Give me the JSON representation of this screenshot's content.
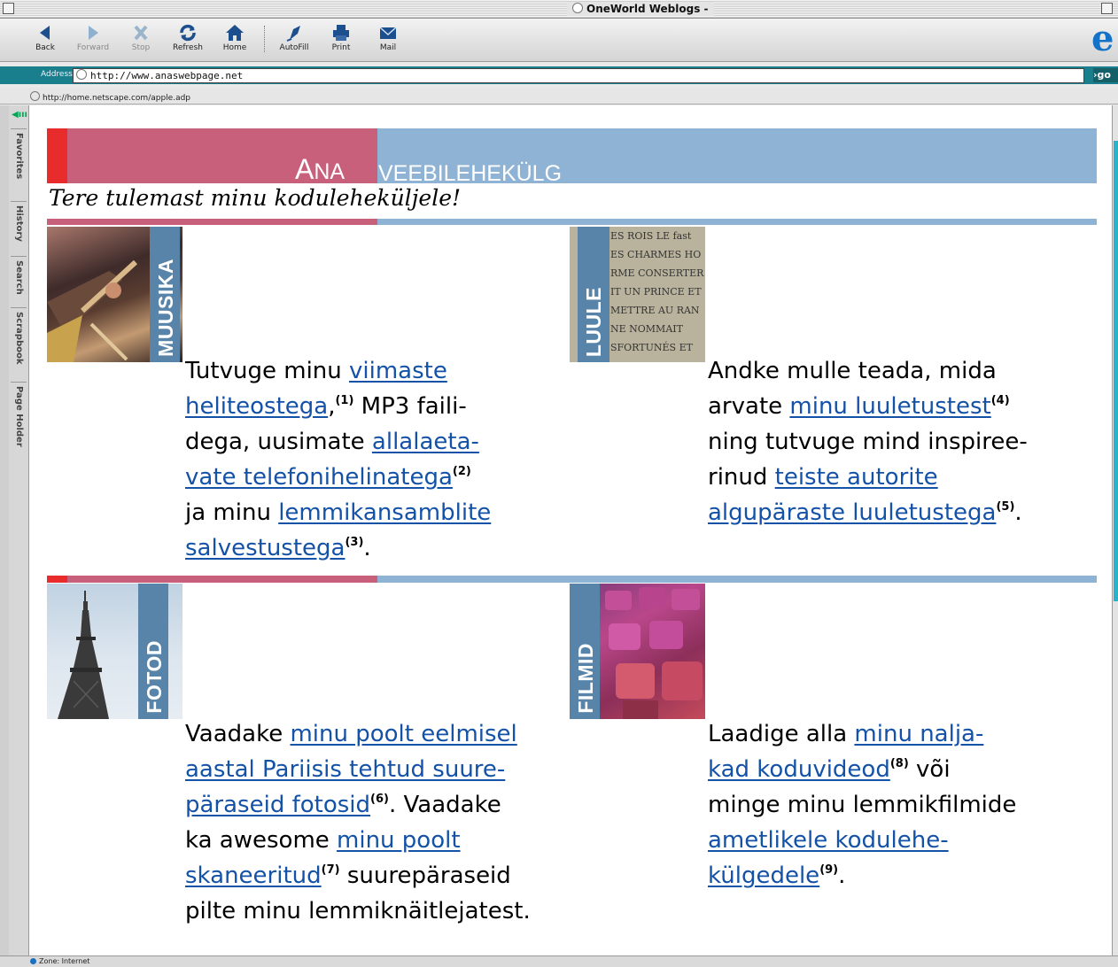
{
  "window": {
    "title": "OneWorld Weblogs -"
  },
  "toolbar": {
    "buttons": [
      {
        "label": "Back",
        "icon": "back-arrow-icon"
      },
      {
        "label": "Forward",
        "icon": "forward-arrow-icon"
      },
      {
        "label": "Stop",
        "icon": "stop-icon"
      },
      {
        "label": "Refresh",
        "icon": "refresh-icon"
      },
      {
        "label": "Home",
        "icon": "home-icon"
      },
      {
        "label": "AutoFill",
        "icon": "autofill-icon"
      },
      {
        "label": "Print",
        "icon": "print-icon"
      },
      {
        "label": "Mail",
        "icon": "mail-icon"
      }
    ],
    "brand_icon": "internet-explorer-e-icon",
    "brand_glyph": "e"
  },
  "address_bar": {
    "label": "Address:",
    "url": "http://www.anaswebpage.net",
    "go_label": "go"
  },
  "favorites_bar": {
    "item": "http://home.netscape.com/apple.adp"
  },
  "explorer_bar": {
    "tabs": [
      "Favorites",
      "History",
      "Search",
      "Scrapbook",
      "Page Holder"
    ],
    "toggle_glyph": "◀ııı"
  },
  "status_bar": {
    "text": "Zone: Internet"
  },
  "page": {
    "banner": {
      "title_first_letter": "A",
      "title_rest": "NA",
      "title_second": "VEEBILEHEKÜLG",
      "welcome": "Tere tulemast minu koduleheküljele!"
    },
    "colors": {
      "red": "#e82c2c",
      "pink": "#c85f7b",
      "blue": "#8fb3d5",
      "label_band": "#5784a8",
      "link": "#1452a8"
    },
    "sections": {
      "music": {
        "label": "MUUSIKA",
        "lines": [
          {
            "pre": "Tutvuge minu ",
            "link": "viimaste",
            "post": "",
            "sup": ""
          },
          {
            "pre": "",
            "link": "heliteostega",
            "post": " MP3 faili-",
            "sup": "(1)",
            "comma": ","
          },
          {
            "pre": "dega, uusimate ",
            "link": "allalaeta-",
            "post": "",
            "sup": ""
          },
          {
            "pre": "",
            "link": "vate telefonihelinatega",
            "post": "",
            "sup": "(2)"
          },
          {
            "pre": "ja minu ",
            "link": "lemmikansamblite",
            "post": "",
            "sup": ""
          },
          {
            "pre": "",
            "link": "salvestustega",
            "post": ".",
            "sup": "(3)"
          }
        ]
      },
      "poetry": {
        "label": "LUULE",
        "image_text": [
          "ES ROIS LE fast",
          "ES CHARMES HO",
          "RME CONSERTER",
          "IT UN PRINCE ET",
          "METTRE AU RAN",
          "NE NOMMAIT",
          "SFORTUNÉS ET"
        ],
        "lines": [
          {
            "pre": "Andke mulle teada, mida",
            "link": "",
            "post": "",
            "sup": ""
          },
          {
            "pre": "arvate ",
            "link": "minu luuletustest",
            "post": "",
            "sup": "(4)"
          },
          {
            "pre": "ning tutvuge mind inspiree-",
            "link": "",
            "post": "",
            "sup": ""
          },
          {
            "pre": "rinud ",
            "link": "teiste autorite",
            "post": "",
            "sup": ""
          },
          {
            "pre": "",
            "link": "algupäraste luuletustega",
            "post": ".",
            "sup": "(5)"
          }
        ]
      },
      "photos": {
        "label": "FOTOD",
        "lines": [
          {
            "pre": "Vaadake ",
            "link": "minu poolt eelmisel",
            "post": "",
            "sup": ""
          },
          {
            "pre": "",
            "link": "aastal Pariisis tehtud suure-",
            "post": "",
            "sup": ""
          },
          {
            "pre": "",
            "link": "päraseid fotosid",
            "post": ". Vaadake",
            "sup": "(6)"
          },
          {
            "pre": "ka  awesome ",
            "link": "minu poolt",
            "post": "",
            "sup": ""
          },
          {
            "pre": "",
            "link": "skaneeritud",
            "post": " suurepäraseid",
            "sup": "(7)"
          },
          {
            "pre": "pilte minu lemmiknäitlejatest.",
            "link": "",
            "post": "",
            "sup": ""
          }
        ]
      },
      "movies": {
        "label": "FILMID",
        "lines": [
          {
            "pre": "Laadige alla ",
            "link": "minu nalja-",
            "post": "",
            "sup": ""
          },
          {
            "pre": "",
            "link": "kad koduvideod",
            "post": " või",
            "sup": "(8)"
          },
          {
            "pre": "minge minu lemmikfilmide",
            "link": "",
            "post": "",
            "sup": ""
          },
          {
            "pre": "",
            "link": "ametlikele kodulehe-",
            "post": "",
            "sup": ""
          },
          {
            "pre": "",
            "link": "külgedele",
            "post": ".",
            "sup": "(9)"
          }
        ]
      }
    }
  }
}
